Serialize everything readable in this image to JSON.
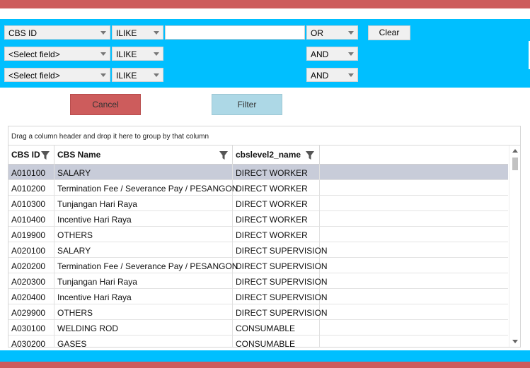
{
  "filter_rows": [
    {
      "field": "CBS ID",
      "operator": "ILIKE",
      "value": "",
      "logic": "OR"
    },
    {
      "field": "<Select field>",
      "operator": "ILIKE",
      "logic": "AND"
    },
    {
      "field": "<Select field>",
      "operator": "ILIKE",
      "logic": "AND"
    }
  ],
  "buttons": {
    "clear": "Clear",
    "cancel": "Cancel",
    "filter": "Filter"
  },
  "grid": {
    "group_hint": "Drag a column header and drop it here to group by that column",
    "columns": [
      "CBS ID",
      "CBS Name",
      "cbslevel2_name"
    ],
    "selected_row": 0,
    "rows": [
      [
        "A010100",
        "SALARY",
        "DIRECT WORKER"
      ],
      [
        "A010200",
        "Termination Fee / Severance Pay / PESANGON",
        "DIRECT WORKER"
      ],
      [
        "A010300",
        "Tunjangan Hari Raya",
        "DIRECT WORKER"
      ],
      [
        "A010400",
        "Incentive Hari Raya",
        "DIRECT WORKER"
      ],
      [
        "A019900",
        "OTHERS",
        "DIRECT WORKER"
      ],
      [
        "A020100",
        "SALARY",
        "DIRECT SUPERVISION"
      ],
      [
        "A020200",
        "Termination Fee / Severance Pay / PESANGON",
        "DIRECT SUPERVISION"
      ],
      [
        "A020300",
        "Tunjangan Hari Raya",
        "DIRECT SUPERVISION"
      ],
      [
        "A020400",
        "Incentive Hari Raya",
        "DIRECT SUPERVISION"
      ],
      [
        "A029900",
        "OTHERS",
        "DIRECT SUPERVISION"
      ],
      [
        "A030100",
        "WELDING ROD",
        "CONSUMABLE"
      ],
      [
        "A030200",
        "GASES",
        "CONSUMABLE"
      ]
    ]
  },
  "colors": {
    "accent_red": "#cd5c5c",
    "accent_blue": "#00bfff",
    "filter_button": "#add8e6",
    "selected_row": "#c8ccd9"
  },
  "icons": {
    "column_filter": "funnel-icon",
    "dropdown": "chevron-down-icon",
    "scroll_up": "scroll-up-arrow-icon",
    "scroll_down": "scroll-down-arrow-icon"
  }
}
